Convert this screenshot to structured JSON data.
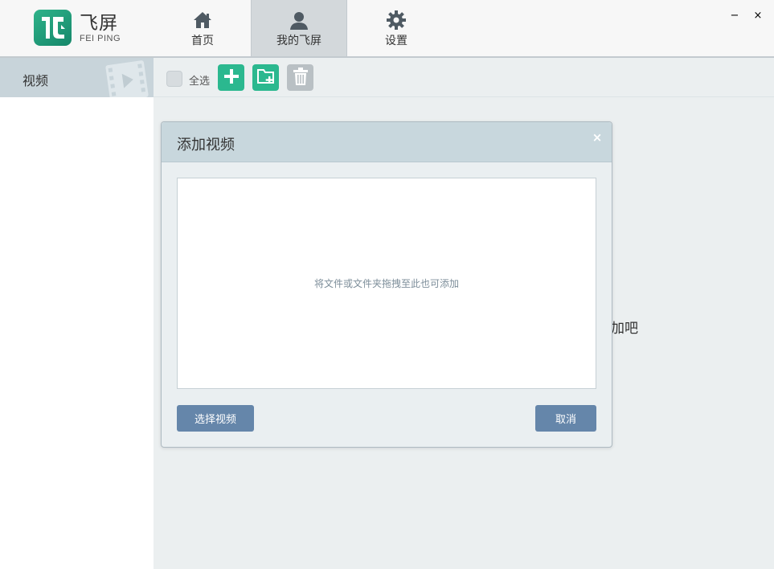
{
  "app": {
    "logo_cn": "飞屏",
    "logo_en": "FEI PING",
    "brand_color": "#22a37d"
  },
  "nav": {
    "tabs": [
      {
        "label": "首页",
        "icon": "home-icon"
      },
      {
        "label": "我的飞屏",
        "icon": "user-icon",
        "active": true
      },
      {
        "label": "设置",
        "icon": "gear-icon"
      }
    ]
  },
  "window": {
    "minimize": "−",
    "close": "×"
  },
  "sidebar": {
    "items": [
      {
        "label": "视频",
        "icon": "film-play-icon",
        "active": true
      }
    ]
  },
  "toolbar": {
    "select_all_label": "全选",
    "add_icon": "plus-icon",
    "add_folder_icon": "folder-plus-icon",
    "delete_icon": "trash-icon",
    "accent": "#2bb88f"
  },
  "main": {
    "background_hint_partial": "加吧"
  },
  "dialog": {
    "title": "添加视频",
    "close": "×",
    "drop_hint": "将文件或文件夹拖拽至此也可添加",
    "choose_label": "选择视频",
    "cancel_label": "取消",
    "button_color": "#6586aa"
  }
}
